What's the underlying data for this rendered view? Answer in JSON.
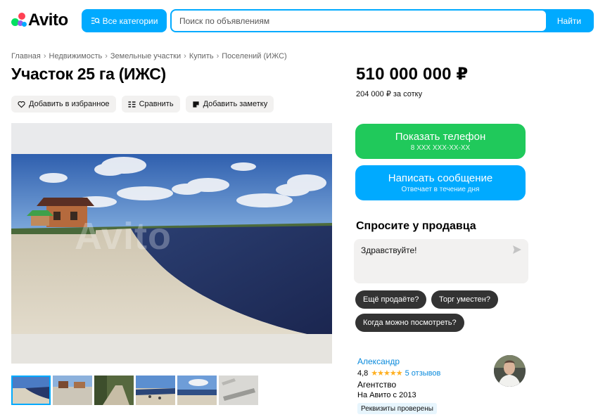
{
  "header": {
    "logo_text": "Avito",
    "categories_label": "Все категории",
    "search_placeholder": "Поиск по объявлениям",
    "search_button": "Найти"
  },
  "breadcrumb": [
    "Главная",
    "Недвижимость",
    "Земельные участки",
    "Купить",
    "Поселений (ИЖС)"
  ],
  "listing": {
    "title": "Участок 25 га (ИЖС)",
    "actions": {
      "favorite": "Добавить в избранное",
      "compare": "Сравнить",
      "note": "Добавить заметку"
    },
    "photo_watermark": "Avito",
    "thumbnail_count": 6
  },
  "price": {
    "total": "510 000 000 ₽",
    "per_unit": "204 000 ₽ за сотку"
  },
  "contact": {
    "phone_label": "Показать телефон",
    "phone_sub": "8 XXX XXX-XX-XX",
    "message_label": "Написать сообщение",
    "message_sub": "Отвечает в течение дня"
  },
  "ask": {
    "title": "Спросите у продавца",
    "message_value": "Здравствуйте!",
    "chips": [
      "Ещё продаёте?",
      "Торг уместен?",
      "Когда можно посмотреть?"
    ]
  },
  "seller": {
    "name": "Александр",
    "rating": "4,8",
    "stars": "★★★★★",
    "reviews": "5 отзывов",
    "type": "Агентство",
    "since": "На Авито с 2013",
    "badge": "Реквизиты проверены"
  },
  "colors": {
    "accent": "#00aaff",
    "phone_button": "#20c95b",
    "link": "#0a8adc",
    "star": "#ffb021",
    "chip": "#333333"
  }
}
